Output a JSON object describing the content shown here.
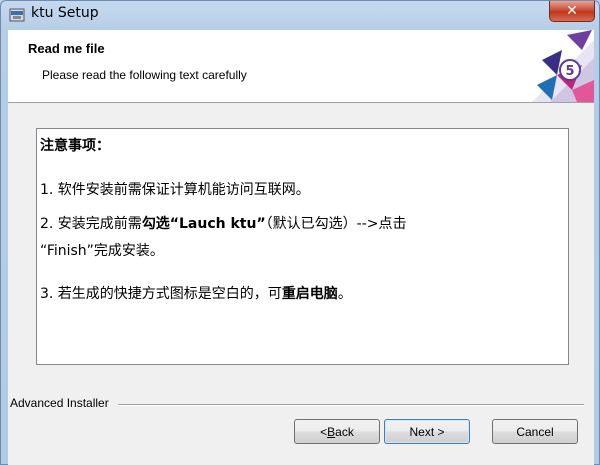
{
  "window": {
    "title": "ktu Setup",
    "close_label": "✕"
  },
  "header": {
    "title": "Read me file",
    "subtitle": "Please read the following text carefully"
  },
  "readme": {
    "heading": "注意事项：",
    "item1": "1. 软件安装前需保证计算机能访问互联网。",
    "item2_prefix": "2. 安装完成前需",
    "item2_bold": "勾选“Lauch ktu”",
    "item2_suffix": "（默认已勾选）-->点击",
    "item2_line2": "“Finish”完成安装。",
    "item3_prefix": "3. 若生成的快捷方式图标是空白的，可",
    "item3_bold": "重启电脑",
    "item3_suffix": "。"
  },
  "footer": {
    "installer_label": "Advanced Installer"
  },
  "buttons": {
    "back_prefix": "< ",
    "back_access": "B",
    "back_rest": "ack",
    "next": "Next >",
    "cancel": "Cancel"
  },
  "icons": {
    "app": "installer-icon",
    "logo": "ktu-logo",
    "close": "close-icon"
  }
}
